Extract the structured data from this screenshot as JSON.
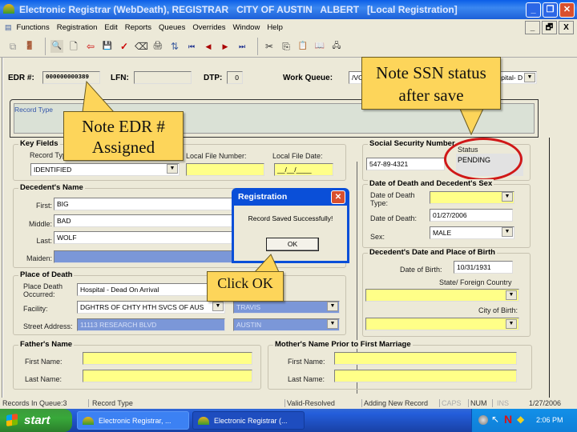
{
  "window": {
    "title": "Electronic Registrar (WebDeath), REGISTRAR   CITY OF AUSTIN   ALBERT   [Local Registration]",
    "controls": {
      "minimize": "_",
      "restore": "❐",
      "close": "✕"
    }
  },
  "menu": {
    "items": [
      "Functions",
      "Registration",
      "Edit",
      "Reports",
      "Queues",
      "Overrides",
      "Window",
      "Help"
    ],
    "mdi_controls": {
      "minimize": "_",
      "restore": "🗗",
      "close": "X"
    }
  },
  "toolbar": {
    "buttons": [
      {
        "name": "cascade-icon",
        "glyph": "⧉"
      },
      {
        "name": "exit-door-icon",
        "glyph": "🚪"
      },
      {
        "name": "binoculars-search-icon",
        "glyph": "🔍"
      },
      {
        "name": "new-document-icon",
        "glyph": "🗋"
      },
      {
        "name": "import-record-icon",
        "glyph": "⇦"
      },
      {
        "name": "save-floppy-icon",
        "glyph": "💾"
      },
      {
        "name": "ssn-verify-icon",
        "glyph": "✓"
      },
      {
        "name": "eraser-icon",
        "glyph": "⌫"
      },
      {
        "name": "print-icon",
        "glyph": "🖨"
      },
      {
        "name": "sort-icon",
        "glyph": "⇅"
      },
      {
        "name": "first-record-icon",
        "glyph": "⏮"
      },
      {
        "name": "previous-record-icon",
        "glyph": "◀"
      },
      {
        "name": "next-record-icon",
        "glyph": "▶"
      },
      {
        "name": "last-record-icon",
        "glyph": "⏭"
      },
      {
        "name": "cut-icon",
        "glyph": "✂"
      },
      {
        "name": "copy-icon",
        "glyph": "⎘"
      },
      {
        "name": "paste-icon",
        "glyph": "📋"
      },
      {
        "name": "book-icon",
        "glyph": "📖"
      },
      {
        "name": "network-record-icon",
        "glyph": "🖧"
      }
    ]
  },
  "header": {
    "edr_label": "EDR #:",
    "edr_value": "000000000389",
    "lfn_label": "LFN:",
    "lfn_value": "",
    "dtp_label": "DTP:",
    "dtp_value": "0",
    "work_queue_label": "Work Queue:",
    "work_queue_value_left": "/VC",
    "work_queue_value_right": "spital- D"
  },
  "record_type_panel": {
    "label": "Record Type"
  },
  "key_fields": {
    "title": "Key Fields",
    "record_type_label": "Record Type",
    "record_type_value": "IDENTIFIED",
    "local_file_number_label": "Local File Number:",
    "local_file_number_value": "",
    "local_file_date_label": "Local File Date:",
    "local_file_date_value": "__/__/____"
  },
  "ssn": {
    "title": "Social Security Number",
    "value": "547-89-4321",
    "status_label": "Status",
    "status_value": "PENDING"
  },
  "decedent_name": {
    "title": "Decedent's Name",
    "first_label": "First:",
    "first_value": "BIG",
    "middle_label": "Middle:",
    "middle_value": "BAD",
    "last_label": "Last:",
    "last_value": "WOLF",
    "maiden_label": "Maiden:",
    "maiden_value": ""
  },
  "death_sex": {
    "title": "Date of Death and Decedent's Sex",
    "type_label": "Date of Death Type:",
    "type_value": "",
    "date_label": "Date of Death:",
    "date_value": "01/27/2006",
    "sex_label": "Sex:",
    "sex_value": "MALE"
  },
  "birth": {
    "title": "Decedent's Date and Place of Birth",
    "dob_label": "Date of Birth:",
    "dob_value": "10/31/1931",
    "state_label": "State/ Foreign Country",
    "state_value": "",
    "city_label": "City of Birth:",
    "city_value": ""
  },
  "place_of_death": {
    "title": "Place of Death",
    "occurred_label": "Place Death Occurred:",
    "occurred_value": "Hospital - Dead On Arrival",
    "facility_label": "Facility:",
    "facility_value": "DGHTRS OF CHTY HTH SVCS OF AUS",
    "street_label": "Street Address:",
    "street_value": "11113 RESEARCH BLVD",
    "county_value": "TRAVIS",
    "city_value": "AUSTIN"
  },
  "father": {
    "title": "Father's Name",
    "first_label": "First Name:",
    "first_value": "",
    "last_label": "Last Name:",
    "last_value": ""
  },
  "mother": {
    "title": "Mother's Name Prior to First Marriage",
    "first_label": "First Name:",
    "first_value": "",
    "last_label": "Last Name:",
    "last_value": ""
  },
  "dialog": {
    "title": "Registration",
    "message": "Record Saved Successfully!",
    "ok_label": "OK",
    "close_glyph": "✕"
  },
  "callouts": {
    "edr": "Note EDR # Assigned",
    "ssn": "Note SSN status after save",
    "ok": "Click OK"
  },
  "statusbar": {
    "records_in_queue": "Records In Queue:3",
    "record_type": "Record Type",
    "validation": "Valid-Resolved",
    "mode": "Adding New Record",
    "caps": "CAPS",
    "num": "NUM",
    "ins": "INS",
    "date": "1/27/2006"
  },
  "taskbar": {
    "start_label": "start",
    "tasks": [
      "Electronic Registrar, ...",
      "Electronic Registrar (..."
    ],
    "clock": "2:06 PM"
  }
}
